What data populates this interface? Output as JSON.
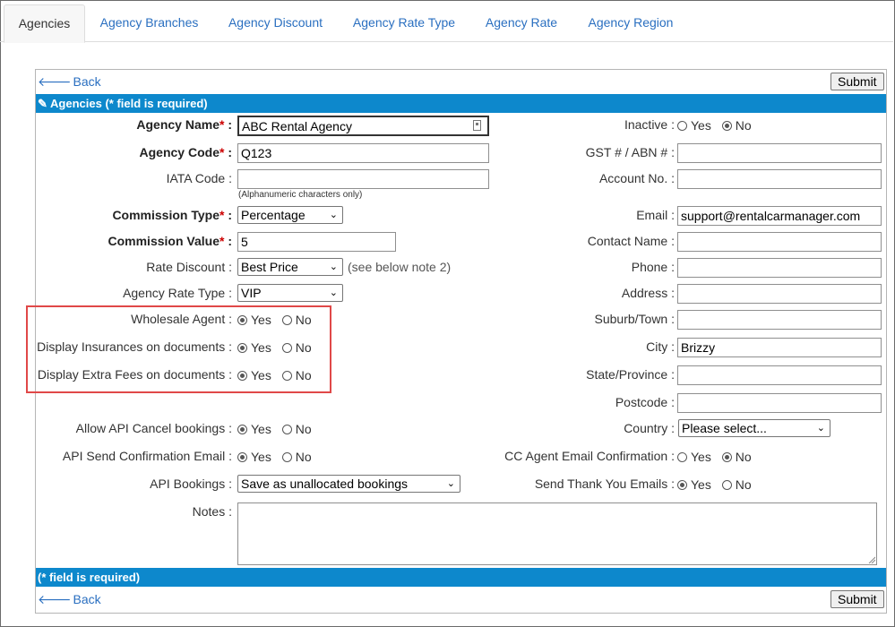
{
  "tabs": [
    {
      "label": "Agencies",
      "active": true
    },
    {
      "label": "Agency Branches"
    },
    {
      "label": "Agency Discount"
    },
    {
      "label": "Agency Rate Type"
    },
    {
      "label": "Agency Rate"
    },
    {
      "label": "Agency Region"
    }
  ],
  "nav": {
    "back_label": "Back",
    "submit_label": "Submit"
  },
  "header_bar": "Agencies (* field is required)",
  "footer_bar": "(* field is required)",
  "left": {
    "agency_name": {
      "label": "Agency Name",
      "value": "ABC Rental Agency"
    },
    "agency_code": {
      "label": "Agency Code",
      "value": "Q123"
    },
    "iata_code": {
      "label": "IATA Code",
      "value": "",
      "hint": "(Alphanumeric characters only)"
    },
    "commission_type": {
      "label": "Commission Type",
      "value": "Percentage"
    },
    "commission_value": {
      "label": "Commission Value",
      "value": "5"
    },
    "rate_discount": {
      "label": "Rate Discount",
      "value": "Best Price",
      "note": "(see below note 2)"
    },
    "agency_rate_type": {
      "label": "Agency Rate Type",
      "value": "VIP"
    },
    "wholesale_agent": {
      "label": "Wholesale Agent",
      "selected": "Yes"
    },
    "display_insurances": {
      "label": "Display Insurances on documents",
      "selected": "Yes"
    },
    "display_extra_fees": {
      "label": "Display Extra Fees on documents",
      "selected": "Yes"
    },
    "allow_api_cancel": {
      "label": "Allow API Cancel bookings",
      "selected": "Yes"
    },
    "api_send_confirmation": {
      "label": "API Send Confirmation Email",
      "selected": "Yes"
    },
    "api_bookings": {
      "label": "API Bookings",
      "value": "Save as unallocated bookings"
    },
    "notes": {
      "label": "Notes",
      "value": ""
    }
  },
  "right": {
    "inactive": {
      "label": "Inactive",
      "selected": "No"
    },
    "gst": {
      "label": "GST # / ABN #",
      "value": ""
    },
    "account_no": {
      "label": "Account No.",
      "value": ""
    },
    "email": {
      "label": "Email",
      "value": "support@rentalcarmanager.com"
    },
    "contact_name": {
      "label": "Contact Name",
      "value": ""
    },
    "phone": {
      "label": "Phone",
      "value": ""
    },
    "address": {
      "label": "Address",
      "value": ""
    },
    "suburb": {
      "label": "Suburb/Town",
      "value": ""
    },
    "city": {
      "label": "City",
      "value": "Brizzy"
    },
    "state": {
      "label": "State/Province",
      "value": ""
    },
    "postcode": {
      "label": "Postcode",
      "value": ""
    },
    "country": {
      "label": "Country",
      "value": "Please select..."
    },
    "cc_agent_email": {
      "label": "CC Agent Email Confirmation",
      "selected": "No"
    },
    "send_thank_you": {
      "label": "Send Thank You Emails",
      "selected": "Yes"
    }
  },
  "radio_options": {
    "yes": "Yes",
    "no": "No"
  },
  "separator": ":",
  "required_mark": "*",
  "colors": {
    "accent": "#0d88cc",
    "link": "#2a6fc0",
    "required": "#cc0000",
    "highlight": "#e04848"
  }
}
